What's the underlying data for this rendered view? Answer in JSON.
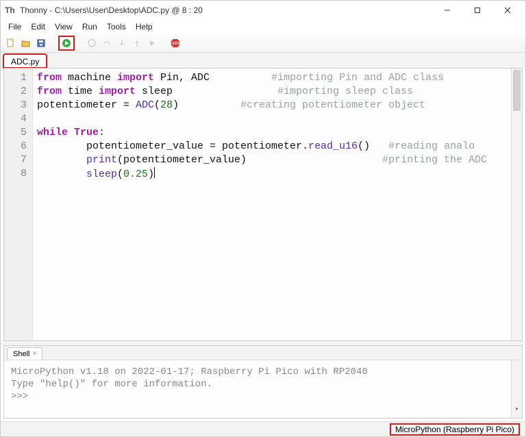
{
  "window": {
    "title": "Thonny  -  C:\\Users\\User\\Desktop\\ADC.py  @  8 : 20"
  },
  "menus": [
    "File",
    "Edit",
    "View",
    "Run",
    "Tools",
    "Help"
  ],
  "tab": {
    "label": "ADC.py"
  },
  "code": {
    "lines": [
      {
        "n": "1",
        "tokens": [
          {
            "t": "from",
            "c": "kw"
          },
          {
            "t": " machine ",
            "c": "ident"
          },
          {
            "t": "import",
            "c": "kw"
          },
          {
            "t": " Pin, ADC",
            "c": "ident"
          },
          {
            "t": "          ",
            "c": "ident"
          },
          {
            "t": "#importing Pin and ADC class",
            "c": "cmt"
          }
        ]
      },
      {
        "n": "2",
        "tokens": [
          {
            "t": "from",
            "c": "kw"
          },
          {
            "t": " time ",
            "c": "ident"
          },
          {
            "t": "import",
            "c": "kw"
          },
          {
            "t": " sleep",
            "c": "ident"
          },
          {
            "t": "                 ",
            "c": "ident"
          },
          {
            "t": "#importing sleep class",
            "c": "cmt"
          }
        ]
      },
      {
        "n": "3",
        "tokens": [
          {
            "t": "potentiometer = ",
            "c": "ident"
          },
          {
            "t": "ADC",
            "c": "fn"
          },
          {
            "t": "(",
            "c": "ident"
          },
          {
            "t": "28",
            "c": "num"
          },
          {
            "t": ")",
            "c": "ident"
          },
          {
            "t": "          ",
            "c": "ident"
          },
          {
            "t": "#creating potentiometer object",
            "c": "cmt"
          }
        ]
      },
      {
        "n": "4",
        "tokens": []
      },
      {
        "n": "5",
        "tokens": [
          {
            "t": "while",
            "c": "kw"
          },
          {
            "t": " ",
            "c": "ident"
          },
          {
            "t": "True",
            "c": "bool"
          },
          {
            "t": ":",
            "c": "ident"
          }
        ]
      },
      {
        "n": "6",
        "tokens": [
          {
            "t": "        potentiometer_value = potentiometer.",
            "c": "ident"
          },
          {
            "t": "read_u16",
            "c": "fn"
          },
          {
            "t": "()",
            "c": "ident"
          },
          {
            "t": "   ",
            "c": "ident"
          },
          {
            "t": "#reading analo",
            "c": "cmt"
          }
        ]
      },
      {
        "n": "7",
        "tokens": [
          {
            "t": "        ",
            "c": "ident"
          },
          {
            "t": "print",
            "c": "fn"
          },
          {
            "t": "(potentiometer_value)",
            "c": "ident"
          },
          {
            "t": "                      ",
            "c": "ident"
          },
          {
            "t": "#printing the ADC",
            "c": "cmt"
          }
        ]
      },
      {
        "n": "8",
        "tokens": [
          {
            "t": "        ",
            "c": "ident"
          },
          {
            "t": "sleep",
            "c": "fn"
          },
          {
            "t": "(",
            "c": "ident"
          },
          {
            "t": "0.25",
            "c": "num"
          },
          {
            "t": ")",
            "c": "ident"
          }
        ],
        "cursor": true
      }
    ]
  },
  "shell": {
    "tab": "Shell",
    "line1": "MicroPython v1.18 on 2022-01-17; Raspberry Pi Pico with RP2040",
    "line2": "Type \"help()\" for more information.",
    "prompt": ">>>"
  },
  "status": {
    "interpreter": "MicroPython (Raspberry Pi Pico)"
  }
}
